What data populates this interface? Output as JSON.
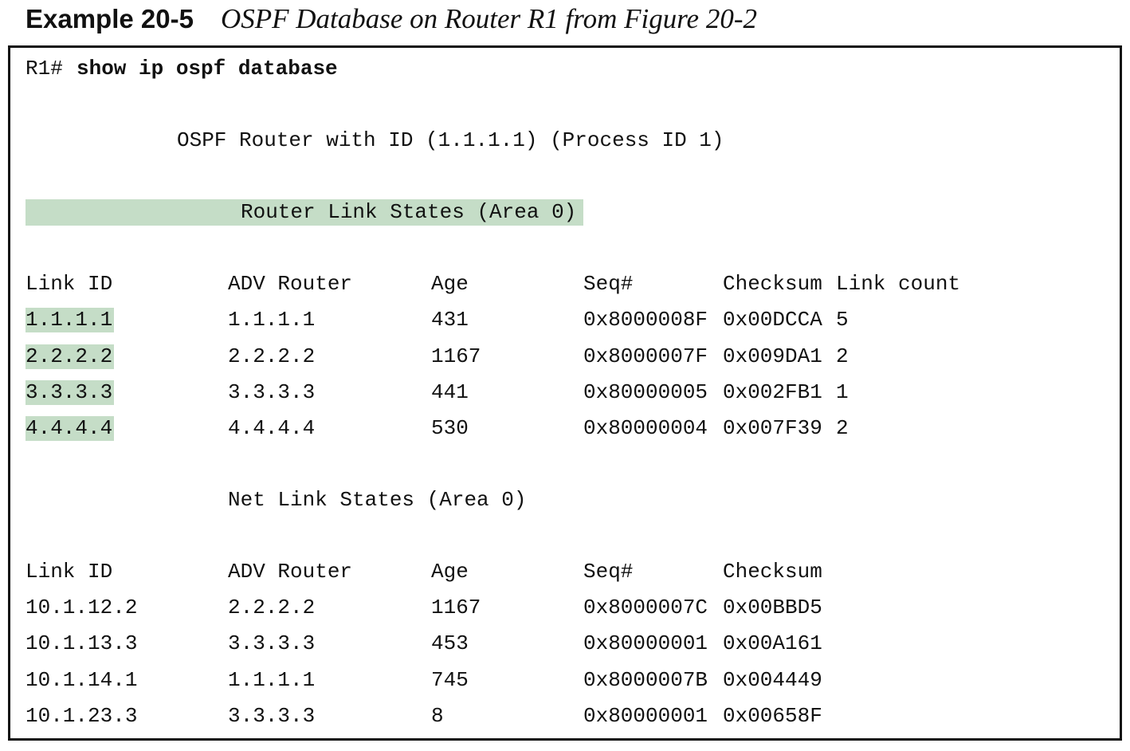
{
  "caption": {
    "label": "Example 20-5",
    "title": "OSPF Database on Router R1 from Figure 20-2"
  },
  "cli": {
    "prompt": "R1#",
    "command": "show ip ospf database",
    "router_banner": "OSPF Router with ID (1.1.1.1) (Process ID 1)"
  },
  "router_links": {
    "heading": "Router Link States (Area 0)",
    "headers": [
      "Link ID",
      "ADV Router",
      "Age",
      "Seq#",
      "Checksum",
      "Link count"
    ],
    "rows": [
      [
        "1.1.1.1",
        "1.1.1.1",
        "431",
        "0x8000008F",
        "0x00DCCA",
        "5"
      ],
      [
        "2.2.2.2",
        "2.2.2.2",
        "1167",
        "0x8000007F",
        "0x009DA1",
        "2"
      ],
      [
        "3.3.3.3",
        "3.3.3.3",
        "441",
        "0x80000005",
        "0x002FB1",
        "1"
      ],
      [
        "4.4.4.4",
        "4.4.4.4",
        "530",
        "0x80000004",
        "0x007F39",
        "2"
      ]
    ]
  },
  "net_links": {
    "heading": "Net Link States (Area 0)",
    "headers": [
      "Link ID",
      "ADV Router",
      "Age",
      "Seq#",
      "Checksum"
    ],
    "rows": [
      [
        "10.1.12.2",
        "2.2.2.2",
        "1167",
        "0x8000007C",
        "0x00BBD5"
      ],
      [
        "10.1.13.3",
        "3.3.3.3",
        "453",
        "0x80000001",
        "0x00A161"
      ],
      [
        "10.1.14.1",
        "1.1.1.1",
        "745",
        "0x8000007B",
        "0x004449"
      ],
      [
        "10.1.23.3",
        "3.3.3.3",
        "8",
        "0x80000001",
        "0x00658F"
      ]
    ]
  },
  "colors": {
    "highlight": "#c5ddc7",
    "text": "#111111",
    "border": "#111111"
  }
}
